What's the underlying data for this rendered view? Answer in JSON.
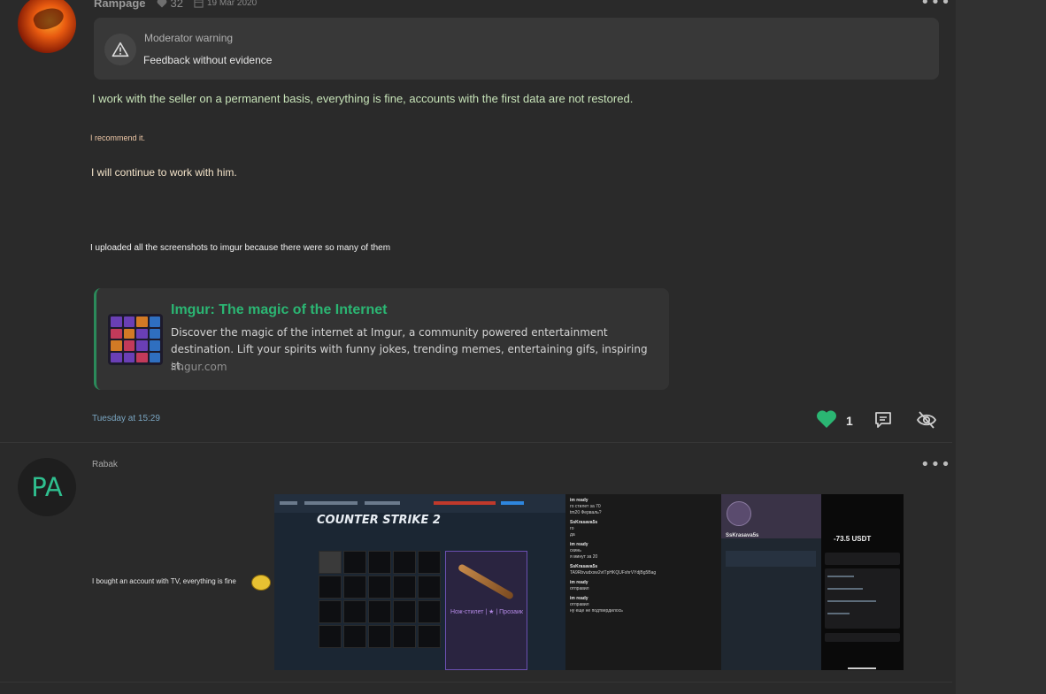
{
  "post1": {
    "username": "Rampage",
    "likes": "32",
    "date": "19 Mar 2020",
    "warning_title": "Moderator warning",
    "warning_text": "Feedback without evidence",
    "lines": [
      "I work with the seller on a permanent basis, everything is fine, accounts with the first data are not restored.",
      "I recommend it.",
      "I will continue to work with him.",
      "I uploaded all the screenshots to imgur because there were so many of them"
    ],
    "link_card": {
      "title": "Imgur: The magic of the Internet",
      "description": "Discover the magic of the internet at Imgur, a community powered entertainment destination. Lift your spirits with funny jokes, trending memes, entertaining gifs, inspiring st...",
      "domain": "imgur.com"
    },
    "timestamp": "Tuesday at 15:29",
    "reaction_count": "1",
    "icons": [
      "heart-icon",
      "reply-icon",
      "hide-icon",
      "more-icon"
    ],
    "accent_color": "#2bb673"
  },
  "post2": {
    "avatar_initials": "PA",
    "username": "Rabak",
    "text": "I bought an account with TV, everything is fine",
    "screenshot": {
      "logo": "COUNTER STRIKE 2",
      "item_label": "Нож-стилет | ★ | Прозаик",
      "tg_name": "SsKrasava5s",
      "amount": "-73.5 USDT",
      "chat": [
        {
          "name": "im ready",
          "text": "го стилет за 70"
        },
        {
          "name": "",
          "text": "tm20 Ферваль?"
        },
        {
          "name": "SsKrasava5s",
          "text": "го"
        },
        {
          "name": "",
          "text": "да"
        },
        {
          "name": "im ready",
          "text": "скинь"
        },
        {
          "name": "",
          "text": "я минут за 20"
        },
        {
          "name": "SsKrasava5s",
          "text": "TA9Rbvudxsw2vtTpHKQUFxhrVYdjBg5Bag"
        },
        {
          "name": "im ready",
          "text": "отправил"
        },
        {
          "name": "im ready",
          "text": "отправил"
        },
        {
          "name": "",
          "text": "ну еще не подтвердилось"
        }
      ]
    }
  }
}
